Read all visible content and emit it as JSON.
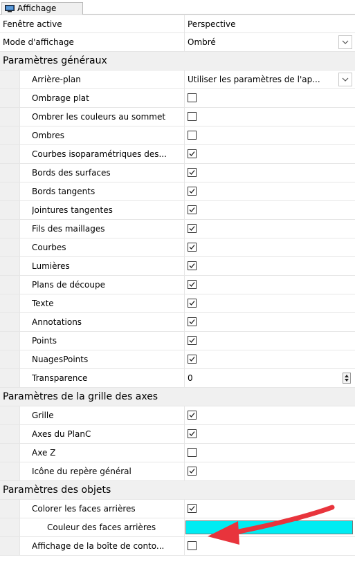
{
  "tab": {
    "label": "Affichage"
  },
  "colors": {
    "backface_color": "#00ecf2",
    "arrow_color": "#e8343c"
  },
  "top_rows": [
    {
      "label": "Fenêtre active",
      "value": "Perspective"
    },
    {
      "label": "Mode d'affichage",
      "value": "Ombré"
    }
  ],
  "sections": [
    {
      "title": "Paramètres généraux",
      "rows": [
        {
          "label": "Arrière-plan",
          "value": "Utiliser les paramètres de l'ap..."
        },
        {
          "label": "Ombrage plat",
          "checked": false
        },
        {
          "label": "Ombrer les couleurs au sommet",
          "checked": false
        },
        {
          "label": "Ombres",
          "checked": false
        },
        {
          "label": "Courbes isoparamétriques des...",
          "checked": true
        },
        {
          "label": "Bords des surfaces",
          "checked": true
        },
        {
          "label": "Bords tangents",
          "checked": true
        },
        {
          "label": "Jointures tangentes",
          "checked": true
        },
        {
          "label": "Fils des maillages",
          "checked": true
        },
        {
          "label": "Courbes",
          "checked": true
        },
        {
          "label": "Lumières",
          "checked": true
        },
        {
          "label": "Plans de découpe",
          "checked": true
        },
        {
          "label": "Texte",
          "checked": true
        },
        {
          "label": "Annotations",
          "checked": true
        },
        {
          "label": "Points",
          "checked": true
        },
        {
          "label": "NuagesPoints",
          "checked": true
        },
        {
          "label": "Transparence",
          "value": "0"
        }
      ]
    },
    {
      "title": "Paramètres de la grille des axes",
      "rows": [
        {
          "label": "Grille",
          "checked": true
        },
        {
          "label": "Axes du PlanC",
          "checked": true
        },
        {
          "label": "Axe Z",
          "checked": false
        },
        {
          "label": "Icône du repère général",
          "checked": true
        }
      ]
    },
    {
      "title": "Paramètres des objets",
      "rows": [
        {
          "label": "Colorer les faces arrières",
          "checked": true
        },
        {
          "label": "Couleur des faces arrières"
        },
        {
          "label": "Affichage de la boîte de conto...",
          "checked": false
        }
      ]
    }
  ]
}
